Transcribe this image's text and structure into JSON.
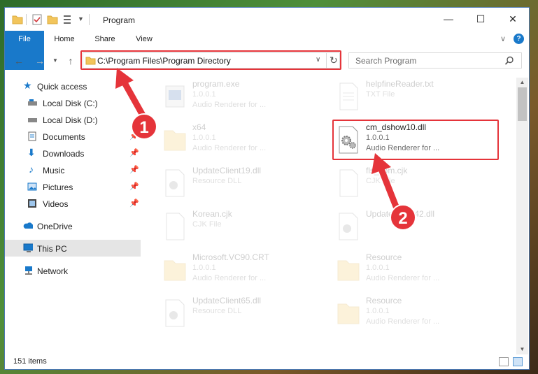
{
  "window": {
    "title": "Program",
    "controls": {
      "minimize": "—",
      "maximize": "☐",
      "close": "✕"
    }
  },
  "ribbon": {
    "tabs": [
      {
        "label": "File"
      },
      {
        "label": "Home"
      },
      {
        "label": "Share"
      },
      {
        "label": "View"
      }
    ],
    "expand_glyph": "∨",
    "help_glyph": "?"
  },
  "address": {
    "path": "C:\\Program Files\\Program Directory",
    "search_placeholder": "Search Program"
  },
  "sidebar": {
    "items": [
      {
        "label": "Quick access",
        "icon": "star-icon"
      },
      {
        "label": "Local Disk (C:)",
        "icon": "drive-icon"
      },
      {
        "label": "Local Disk (D:)",
        "icon": "drive-icon"
      },
      {
        "label": "Documents",
        "icon": "documents-icon",
        "pinned": true
      },
      {
        "label": "Downloads",
        "icon": "downloads-icon",
        "pinned": true
      },
      {
        "label": "Music",
        "icon": "music-icon",
        "pinned": true
      },
      {
        "label": "Pictures",
        "icon": "pictures-icon",
        "pinned": true
      },
      {
        "label": "Videos",
        "icon": "videos-icon",
        "pinned": true
      },
      {
        "label": "OneDrive",
        "icon": "cloud-icon"
      },
      {
        "label": "This PC",
        "icon": "computer-icon",
        "selected": true
      },
      {
        "label": "Network",
        "icon": "network-icon"
      }
    ]
  },
  "files": [
    {
      "name": "program.exe",
      "line2": "1.0.0.1",
      "line3": "Audio Renderer for ...",
      "icon": "exe-icon"
    },
    {
      "name": "helpfineReader.txt",
      "line2": "TXT File",
      "line3": "",
      "icon": "text-file-icon"
    },
    {
      "name": "x64",
      "line2": "1.0.0.1",
      "line3": "Audio Renderer for ...",
      "icon": "folder-icon"
    },
    {
      "name": "cm_dshow10.dll",
      "line2": "1.0.0.1",
      "line3": "Audio Renderer for ...",
      "icon": "dll-gear-icon",
      "highlighted": true
    },
    {
      "name": "UpdateClient19.dll",
      "line2": "Resource DLL",
      "line3": "",
      "icon": "dll-gear-icon"
    },
    {
      "name": "fls_com.cjk",
      "line2": "CJK File",
      "line3": "",
      "icon": "blank-file-icon"
    },
    {
      "name": "Korean.cjk",
      "line2": "CJK File",
      "line3": "",
      "icon": "blank-file-icon"
    },
    {
      "name": "UpdateClient42.dll",
      "line2": "",
      "line3": "",
      "icon": "dll-gear-icon"
    },
    {
      "name": "Microsoft.VC90.CRT",
      "line2": "1.0.0.1",
      "line3": "Audio Renderer for ...",
      "icon": "folder-icon"
    },
    {
      "name": "Resource",
      "line2": "1.0.0.1",
      "line3": "Audio Renderer for ...",
      "icon": "folder-icon"
    },
    {
      "name": "UpdateClient65.dll",
      "line2": "Resource DLL",
      "line3": "",
      "icon": "dll-gear-icon"
    },
    {
      "name": "Resource",
      "line2": "1.0.0.1",
      "line3": "Audio Renderer for ...",
      "icon": "folder-icon"
    }
  ],
  "status": {
    "item_count": "151 items"
  },
  "annotations": {
    "step1": "1",
    "step2": "2",
    "color": "#e5343a"
  }
}
